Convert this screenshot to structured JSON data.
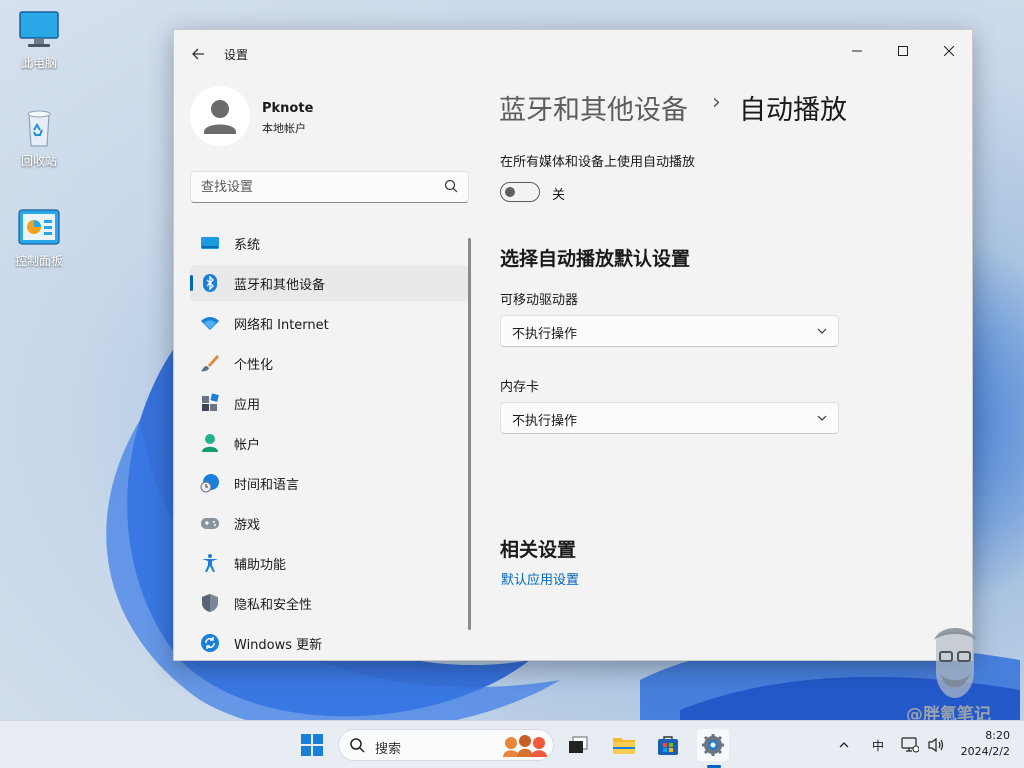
{
  "desktop": {
    "icons": [
      {
        "label": "此电脑",
        "icon": "computer-icon"
      },
      {
        "label": "回收站",
        "icon": "recycle-bin-icon"
      },
      {
        "label": "控制面板",
        "icon": "control-panel-icon"
      }
    ]
  },
  "window": {
    "title": "设置",
    "controls": {
      "minimize": "—",
      "maximize": "☐",
      "close": "✕"
    }
  },
  "user": {
    "name": "Pknote",
    "type": "本地帐户"
  },
  "search": {
    "placeholder": "查找设置"
  },
  "nav": {
    "items": [
      {
        "label": "系统",
        "icon": "system-icon",
        "active": false
      },
      {
        "label": "蓝牙和其他设备",
        "icon": "bluetooth-icon",
        "active": true
      },
      {
        "label": "网络和 Internet",
        "icon": "wifi-icon",
        "active": false
      },
      {
        "label": "个性化",
        "icon": "brush-icon",
        "active": false
      },
      {
        "label": "应用",
        "icon": "apps-icon",
        "active": false
      },
      {
        "label": "帐户",
        "icon": "account-icon",
        "active": false
      },
      {
        "label": "时间和语言",
        "icon": "globe-clock-icon",
        "active": false
      },
      {
        "label": "游戏",
        "icon": "gamepad-icon",
        "active": false
      },
      {
        "label": "辅助功能",
        "icon": "accessibility-icon",
        "active": false
      },
      {
        "label": "隐私和安全性",
        "icon": "shield-icon",
        "active": false
      },
      {
        "label": "Windows 更新",
        "icon": "update-icon",
        "active": false
      }
    ]
  },
  "content": {
    "breadcrumb": {
      "parent": "蓝牙和其他设备",
      "separator": "›",
      "current": "自动播放"
    },
    "autoplay_toggle": {
      "label": "在所有媒体和设备上使用自动播放",
      "state_text": "关",
      "on": false
    },
    "defaults_section": {
      "title": "选择自动播放默认设置",
      "removable_drive": {
        "label": "可移动驱动器",
        "value": "不执行操作"
      },
      "memory_card": {
        "label": "内存卡",
        "value": "不执行操作"
      }
    },
    "related": {
      "title": "相关设置",
      "link": "默认应用设置"
    }
  },
  "taskbar": {
    "search_label": "搜索",
    "tray": {
      "input_method": "中",
      "time": "8:20",
      "date": "2024/2/2"
    }
  },
  "watermark": "@胖氪笔记",
  "colors": {
    "accent": "#0067c0",
    "window_bg": "#f3f3f3"
  }
}
